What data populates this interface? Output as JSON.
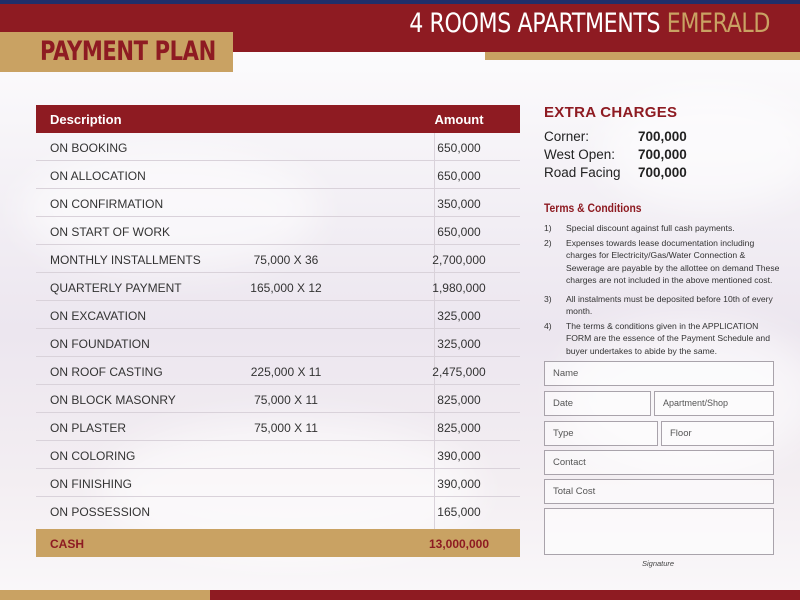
{
  "header": {
    "title_main": "4 ROOMS APARTMENTS",
    "title_accent": "EMERALD",
    "plan_title": "PAYMENT PLAN"
  },
  "table": {
    "headers": [
      "Description",
      "Amount"
    ],
    "rows": [
      {
        "desc": "ON BOOKING",
        "calc": "",
        "amount": "650,000"
      },
      {
        "desc": "ON ALLOCATION",
        "calc": "",
        "amount": "650,000"
      },
      {
        "desc": "ON CONFIRMATION",
        "calc": "",
        "amount": "350,000"
      },
      {
        "desc": "ON START OF WORK",
        "calc": "",
        "amount": "650,000"
      },
      {
        "desc": "MONTHLY INSTALLMENTS",
        "calc": "75,000 X 36",
        "amount": "2,700,000"
      },
      {
        "desc": "QUARTERLY PAYMENT",
        "calc": "165,000 X 12",
        "amount": "1,980,000"
      },
      {
        "desc": "ON EXCAVATION",
        "calc": "",
        "amount": "325,000"
      },
      {
        "desc": "ON FOUNDATION",
        "calc": "",
        "amount": "325,000"
      },
      {
        "desc": "ON ROOF CASTING",
        "calc": "225,000 X 11",
        "amount": "2,475,000"
      },
      {
        "desc": "ON BLOCK MASONRY",
        "calc": "75,000 X 11",
        "amount": "825,000"
      },
      {
        "desc": "ON PLASTER",
        "calc": "75,000 X 11",
        "amount": "825,000"
      },
      {
        "desc": "ON COLORING",
        "calc": "",
        "amount": "390,000"
      },
      {
        "desc": "ON FINISHING",
        "calc": "",
        "amount": "390,000"
      },
      {
        "desc": "ON POSSESSION",
        "calc": "",
        "amount": "165,000"
      }
    ],
    "total": {
      "label": "CASH",
      "amount": "13,000,000"
    }
  },
  "extra_charges": {
    "title": "EXTRA CHARGES",
    "items": [
      {
        "label": "Corner:",
        "value": "700,000"
      },
      {
        "label": "West Open:",
        "value": "700,000"
      },
      {
        "label": "Road Facing",
        "value": "700,000"
      }
    ]
  },
  "terms": {
    "title": "Terms & Conditions",
    "items": [
      {
        "num": "1)",
        "text": "Special discount against full cash payments."
      },
      {
        "num": "2)",
        "text": "Expenses towards lease documentation including charges for Electricity/Gas/Water Connection & Sewerage are payable by the allottee on demand These charges are not included in the above mentioned cost."
      },
      {
        "num": "3)",
        "text": "All instalments must be deposited before 10th of every month."
      },
      {
        "num": "4)",
        "text": "The terms & conditions given in the APPLICATION FORM are the essence of the Payment Schedule and buyer undertakes to abide by the same."
      }
    ]
  },
  "form": {
    "name": "Name",
    "date": "Date",
    "apartment": "Apartment/Shop",
    "type": "Type",
    "floor": "Floor",
    "contact": "Contact",
    "total_cost": "Total Cost",
    "signature": "Signature"
  },
  "colors": {
    "brand_red": "#8e1b22",
    "brand_gold": "#c9a263",
    "top_line": "#1f2f6b"
  }
}
